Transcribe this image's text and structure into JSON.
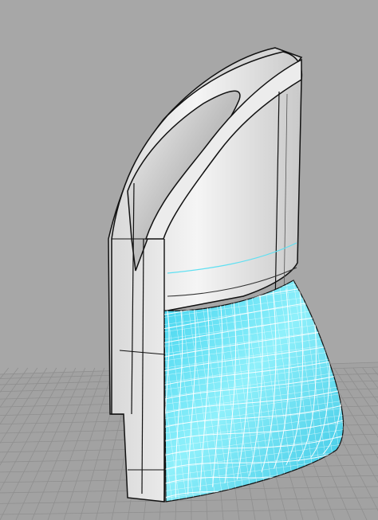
{
  "viewport": {
    "view_mode": "perspective",
    "display_mode": "rendered",
    "grid_visible": true
  },
  "colors": {
    "background": "#a7a7a7",
    "grid_line": "#8f8f8f",
    "grid_floor": "#a2a2a2",
    "object_body": "#e9e9e9",
    "object_edge": "#111111",
    "selected_surface": "#5fe0f2",
    "selection_wire": "#ffffff"
  },
  "scene": {
    "model": "ladle-shell",
    "selected_region": "lower-blue-surface",
    "icons": [
      "perspective-grid-icon",
      "surface-isocurve-icon"
    ]
  }
}
